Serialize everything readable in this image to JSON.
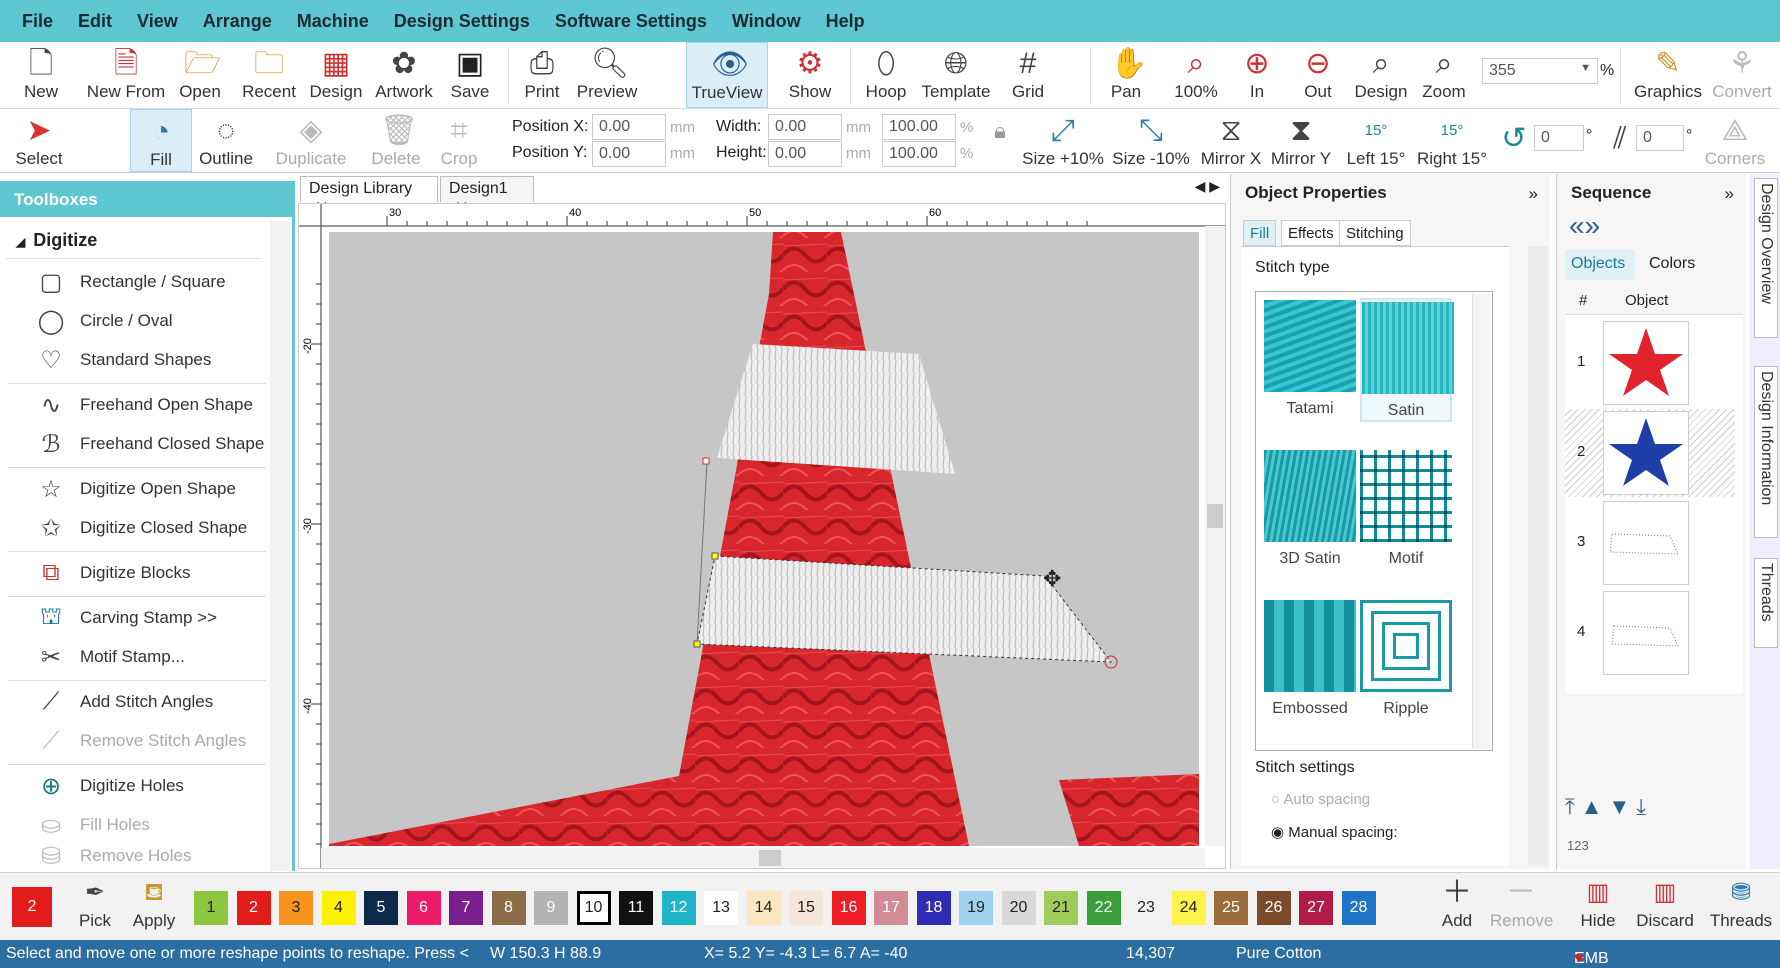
{
  "menu": [
    "File",
    "Edit",
    "View",
    "Arrange",
    "Machine",
    "Design Settings",
    "Software Settings",
    "Window",
    "Help"
  ],
  "toolbar1": {
    "new": "New",
    "new_from": "New From",
    "open": "Open",
    "recent": "Recent",
    "design": "Design",
    "artwork": "Artwork",
    "save": "Save",
    "print": "Print",
    "preview": "Preview",
    "trueview": "TrueView",
    "show": "Show",
    "hoop": "Hoop",
    "template": "Template",
    "grid": "Grid",
    "pan": "Pan",
    "z100": "100%",
    "zin": "In",
    "zout": "Out",
    "zdesign": "Design",
    "zoom": "Zoom",
    "zoom_value": "355",
    "zoom_unit": "%",
    "graphics": "Graphics",
    "convert": "Convert"
  },
  "toolbar2": {
    "select": "Select",
    "fill": "Fill",
    "outline": "Outline",
    "duplicate": "Duplicate",
    "delete": "Delete",
    "crop": "Crop",
    "pos_x_label": "Position X:",
    "pos_y_label": "Position Y:",
    "pos_x": "0.00",
    "pos_y": "0.00",
    "mm": "mm",
    "width_label": "Width:",
    "height_label": "Height:",
    "width": "0.00",
    "height": "0.00",
    "wpct": "100.00",
    "hpct": "100.00",
    "pct": "%",
    "size_up": "Size +10%",
    "size_down": "Size -10%",
    "mirror_x": "Mirror X",
    "mirror_y": "Mirror Y",
    "left15": "Left 15°",
    "right15": "Right 15°",
    "deg15": "15°",
    "rot_value": "0",
    "deg": "°",
    "slant_value": "0",
    "corners": "Corners"
  },
  "toolboxes": {
    "title": "Toolboxes",
    "section": "Digitize",
    "items": [
      {
        "label": "Rectangle / Square",
        "icon": "rectangle-icon"
      },
      {
        "label": "Circle / Oval",
        "icon": "circle-icon"
      },
      {
        "label": "Standard Shapes",
        "icon": "shapes-icon"
      },
      {
        "label": "Freehand Open Shape",
        "icon": "freehand-open-icon"
      },
      {
        "label": "Freehand Closed Shape",
        "icon": "freehand-closed-icon"
      },
      {
        "label": "Digitize Open Shape",
        "icon": "star-open-icon"
      },
      {
        "label": "Digitize Closed Shape",
        "icon": "star-closed-icon"
      },
      {
        "label": "Digitize Blocks",
        "icon": "blocks-icon"
      },
      {
        "label": "Carving Stamp >>",
        "icon": "stamp-icon"
      },
      {
        "label": "Motif Stamp...",
        "icon": "motif-stamp-icon"
      },
      {
        "label": "Add Stitch Angles",
        "icon": "add-angles-icon"
      },
      {
        "label": "Remove Stitch Angles",
        "icon": "remove-angles-icon"
      },
      {
        "label": "Digitize Holes",
        "icon": "holes-icon"
      },
      {
        "label": "Fill Holes",
        "icon": "fill-holes-icon"
      },
      {
        "label": "Remove Holes",
        "icon": "remove-holes-icon"
      }
    ]
  },
  "doc_tabs": [
    "Design Library",
    "Design1"
  ],
  "ruler": {
    "h": [
      "30",
      "40",
      "50",
      "60"
    ],
    "v": [
      "-20",
      "-30",
      "-40"
    ]
  },
  "props": {
    "title": "Object Properties",
    "tabs": [
      "Fill",
      "Effects",
      "Stitching"
    ],
    "stitch_type": "Stitch type",
    "types": [
      "Tatami",
      "Satin",
      "3D Satin",
      "Motif",
      "Embossed",
      "Ripple"
    ],
    "settings": "Stitch settings",
    "auto": "Auto spacing",
    "manual": "Manual spacing:"
  },
  "sequence": {
    "title": "Sequence",
    "tab_objects": "Objects",
    "tab_colors": "Colors",
    "col_num": "#",
    "col_obj": "Object",
    "rows": [
      "1",
      "2",
      "3",
      "4"
    ]
  },
  "side_tabs": [
    "Design Overview",
    "Design Information",
    "Threads"
  ],
  "colors": {
    "current": "2",
    "pick": "Pick",
    "apply": "Apply",
    "swatches": [
      {
        "n": "1",
        "c": "#8dc63f"
      },
      {
        "n": "2",
        "c": "#e21b1b"
      },
      {
        "n": "3",
        "c": "#f7941d"
      },
      {
        "n": "4",
        "c": "#fff200"
      },
      {
        "n": "5",
        "c": "#0d2a4a"
      },
      {
        "n": "6",
        "c": "#ec1c6b"
      },
      {
        "n": "7",
        "c": "#7a1f8e"
      },
      {
        "n": "8",
        "c": "#8b6d4a"
      },
      {
        "n": "9",
        "c": "#b4b4b4"
      },
      {
        "n": "10",
        "c": "#ffffff"
      },
      {
        "n": "11",
        "c": "#111111"
      },
      {
        "n": "12",
        "c": "#1fb6c9"
      },
      {
        "n": "13",
        "c": "#ffffff"
      },
      {
        "n": "14",
        "c": "#fbe6c2"
      },
      {
        "n": "15",
        "c": "#f6e7da"
      },
      {
        "n": "16",
        "c": "#ef1d25"
      },
      {
        "n": "17",
        "c": "#d18b95"
      },
      {
        "n": "18",
        "c": "#2e2bb5"
      },
      {
        "n": "19",
        "c": "#9fd3ef"
      },
      {
        "n": "20",
        "c": "#d8d8d8"
      },
      {
        "n": "21",
        "c": "#9dcc5a"
      },
      {
        "n": "22",
        "c": "#3a9e3a"
      },
      {
        "n": "23",
        "c": "#f2f2f2"
      },
      {
        "n": "24",
        "c": "#fff24d"
      },
      {
        "n": "25",
        "c": "#9c6b3a"
      },
      {
        "n": "26",
        "c": "#7a4a2a"
      },
      {
        "n": "27",
        "c": "#b01c45"
      },
      {
        "n": "28",
        "c": "#1f74c8"
      }
    ],
    "add": "Add",
    "remove": "Remove",
    "hide": "Hide",
    "discard": "Discard",
    "threads": "Threads"
  },
  "status": {
    "msg": "Select and move one or more reshape points to reshape. Press <",
    "size": "W 150.3 H  88.9",
    "coords": "X=   5.2 Y=  -4.3 L=   6.7 A= -40",
    "stitches": "14,307",
    "thread": "Pure Cotton",
    "grade": "EMB Grade: A"
  }
}
